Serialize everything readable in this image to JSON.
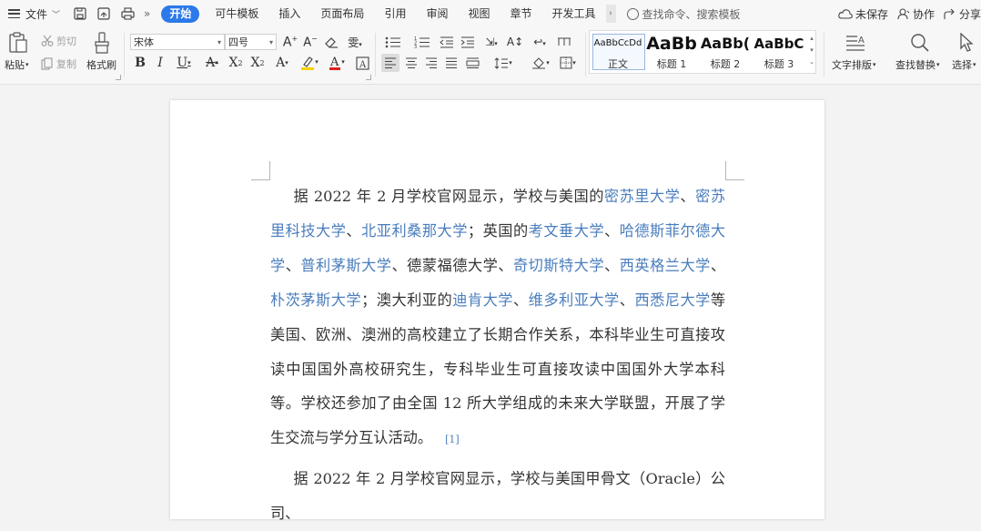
{
  "menu": {
    "file_label": "文件",
    "tabs": [
      "开始",
      "可牛模板",
      "插入",
      "页面布局",
      "引用",
      "审阅",
      "视图",
      "章节",
      "开发工具"
    ],
    "active_tab": "开始",
    "search_placeholder": "查找命令、搜索模板",
    "unsaved_label": "未保存",
    "collab_label": "协作",
    "share_label": "分享"
  },
  "ribbon": {
    "paste_label": "粘贴",
    "cut_label": "剪切",
    "copy_label": "复制",
    "format_painter_label": "格式刷",
    "font_name": "宋体",
    "font_size": "四号",
    "styles": [
      {
        "preview": "AaBbCcDd",
        "name": "正文"
      },
      {
        "preview": "AaBb",
        "name": "标题 1"
      },
      {
        "preview": "AaBb(",
        "name": "标题 2"
      },
      {
        "preview": "AaBbC",
        "name": "标题 3"
      }
    ],
    "text_layout_label": "文字排版",
    "find_replace_label": "查找替换",
    "select_label": "选择",
    "colors": {
      "highlight": "#f5d300",
      "font_color": "#e02020",
      "accent": "#2b79ea",
      "link": "#4a7dbd"
    }
  },
  "document": {
    "para1": {
      "t0": "据 2022 年 2 月学校官网显示，学校与美国的",
      "l1": "密苏里大学",
      "t1": "、",
      "l2": "密苏里科技大学",
      "t2": "、",
      "l3": "北亚利桑那大学",
      "t3": "；英国的",
      "l4": "考文垂大学",
      "t4": "、",
      "l5": "哈德斯菲尔德大学",
      "t5": "、",
      "l6": "普利茅斯大学",
      "t6": "、德蒙福德大学、",
      "l7": "奇切斯特大学",
      "t7": "、",
      "l8": "西英格兰大学",
      "t8": "、",
      "l9": "朴茨茅斯大学",
      "t9": "；澳大利亚的",
      "l10": "迪肯大学",
      "t10": "、",
      "l11": "维多利亚大学",
      "t11": "、",
      "l12": "西悉尼大学",
      "t12": "等美国、欧洲、澳洲的高校建立了长期合作关系，本科毕业生可直接攻读中国国外高校研究生，专科毕业生可直接攻读中国国外大学本科等。学校还参加了由全国 12 所大学组成的未来大学联盟，开展了学生交流与学分互认活动。",
      "ref": "[1]"
    },
    "para2": "据 2022 年 2 月学校官网显示，学校与美国甲骨文（Oracle）公司、"
  }
}
